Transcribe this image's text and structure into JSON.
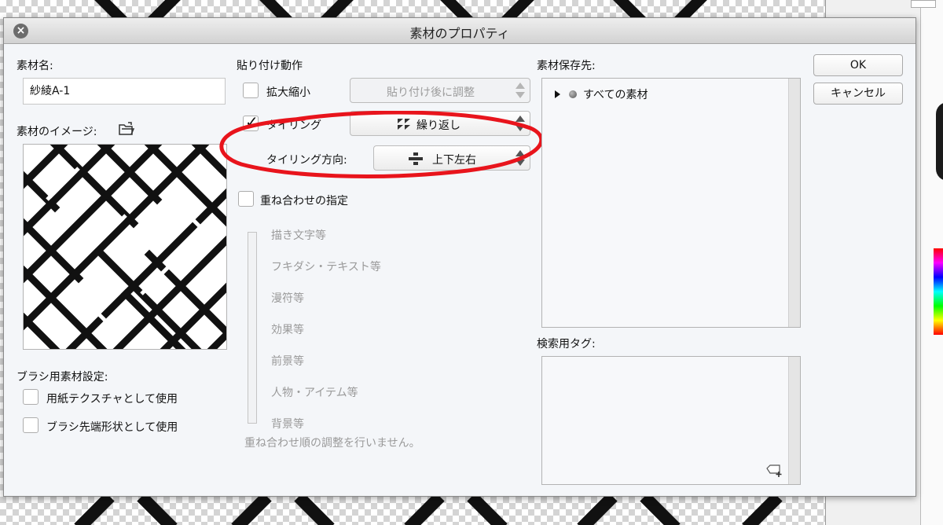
{
  "dialog": {
    "title": "素材のプロパティ",
    "material_name_label": "素材名:",
    "material_name_value": "紗綾A-1",
    "material_image_label": "素材のイメージ:",
    "brush_settings_label": "ブラシ用素材設定:",
    "paper_texture_label": "用紙テクスチャとして使用",
    "brush_tip_label": "ブラシ先端形状として使用",
    "paste_behavior_label": "貼り付け動作",
    "scale_label": "拡大縮小",
    "scale_popup": "貼り付け後に調整",
    "tiling_label": "タイリング",
    "tiling_checked": true,
    "tiling_popup": "繰り返し",
    "tiling_direction_label": "タイリング方向:",
    "tiling_direction_popup": "上下左右",
    "overlay_label": "重ね合わせの指定",
    "layer_order": [
      "描き文字等",
      "フキダシ・テキスト等",
      "漫符等",
      "効果等",
      "前景等",
      "人物・アイテム等",
      "背景等"
    ],
    "overlay_note": "重ね合わせ順の調整を行いません。",
    "save_location_label": "素材保存先:",
    "tree_item": "すべての素材",
    "search_tag_label": "検索用タグ:",
    "ok_button": "OK",
    "cancel_button": "キャンセル"
  },
  "colors": {
    "annotation": "#e8141c",
    "dialog_bg": "#f4f6f9"
  }
}
